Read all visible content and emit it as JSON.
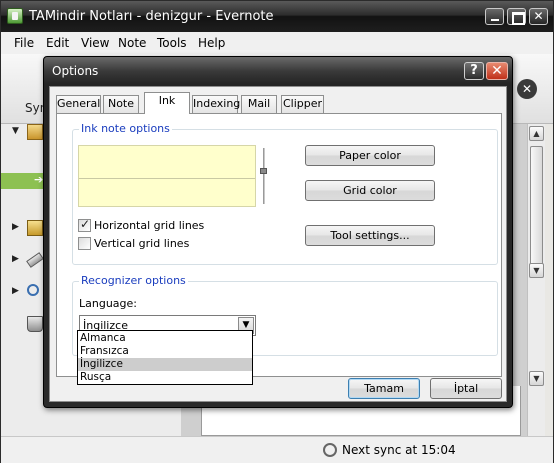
{
  "main_window": {
    "title": "TAMindir Notları - denizgur - Evernote",
    "minimize_glyph": "",
    "maximize_glyph": "",
    "close_glyph": "✕"
  },
  "menu": {
    "items": [
      "File",
      "Edit",
      "View",
      "Note",
      "Tools",
      "Help"
    ]
  },
  "toolbar": {
    "sync_label": "Sync",
    "close_glyph": "✕"
  },
  "left_panel": {
    "tree_arrows": [
      "▼",
      "▶",
      "▶",
      "▶"
    ],
    "selected_arrow": "➔"
  },
  "scrollbar": {
    "up_glyph": "▲",
    "down_glyph": "▼",
    "mid_glyph": "▼"
  },
  "status_bar": {
    "sync_status": "Next sync at 15:04"
  },
  "dialog": {
    "title": "Options",
    "help_glyph": "?",
    "close_glyph": "✕",
    "tabs": [
      "General",
      "Note",
      "Ink",
      "Indexing",
      "Mail",
      "Clipper"
    ],
    "active_tab": "Ink",
    "ink_group": {
      "label": "Ink note options",
      "paper_color_button": "Paper color",
      "grid_color_button": "Grid color",
      "tool_settings_button": "Tool settings...",
      "horizontal_grid": {
        "label": "Horizontal grid lines",
        "checked": true
      },
      "vertical_grid": {
        "label": "Vertical grid lines",
        "checked": false
      }
    },
    "recognizer_group": {
      "label": "Recognizer options",
      "language_label": "Language:",
      "selected_language": "İngilizce",
      "dropdown_arrow": "▼",
      "options": [
        "Almanca",
        "Fransızca",
        "İngilizce",
        "Rusça"
      ],
      "highlighted_option": "İngilizce"
    },
    "ok_button": "Tamam",
    "cancel_button": "İptal"
  },
  "colors": {
    "ink_paper": "#ffffcc",
    "selection_green": "#8dc152",
    "group_label_blue": "#1a3dbe"
  }
}
